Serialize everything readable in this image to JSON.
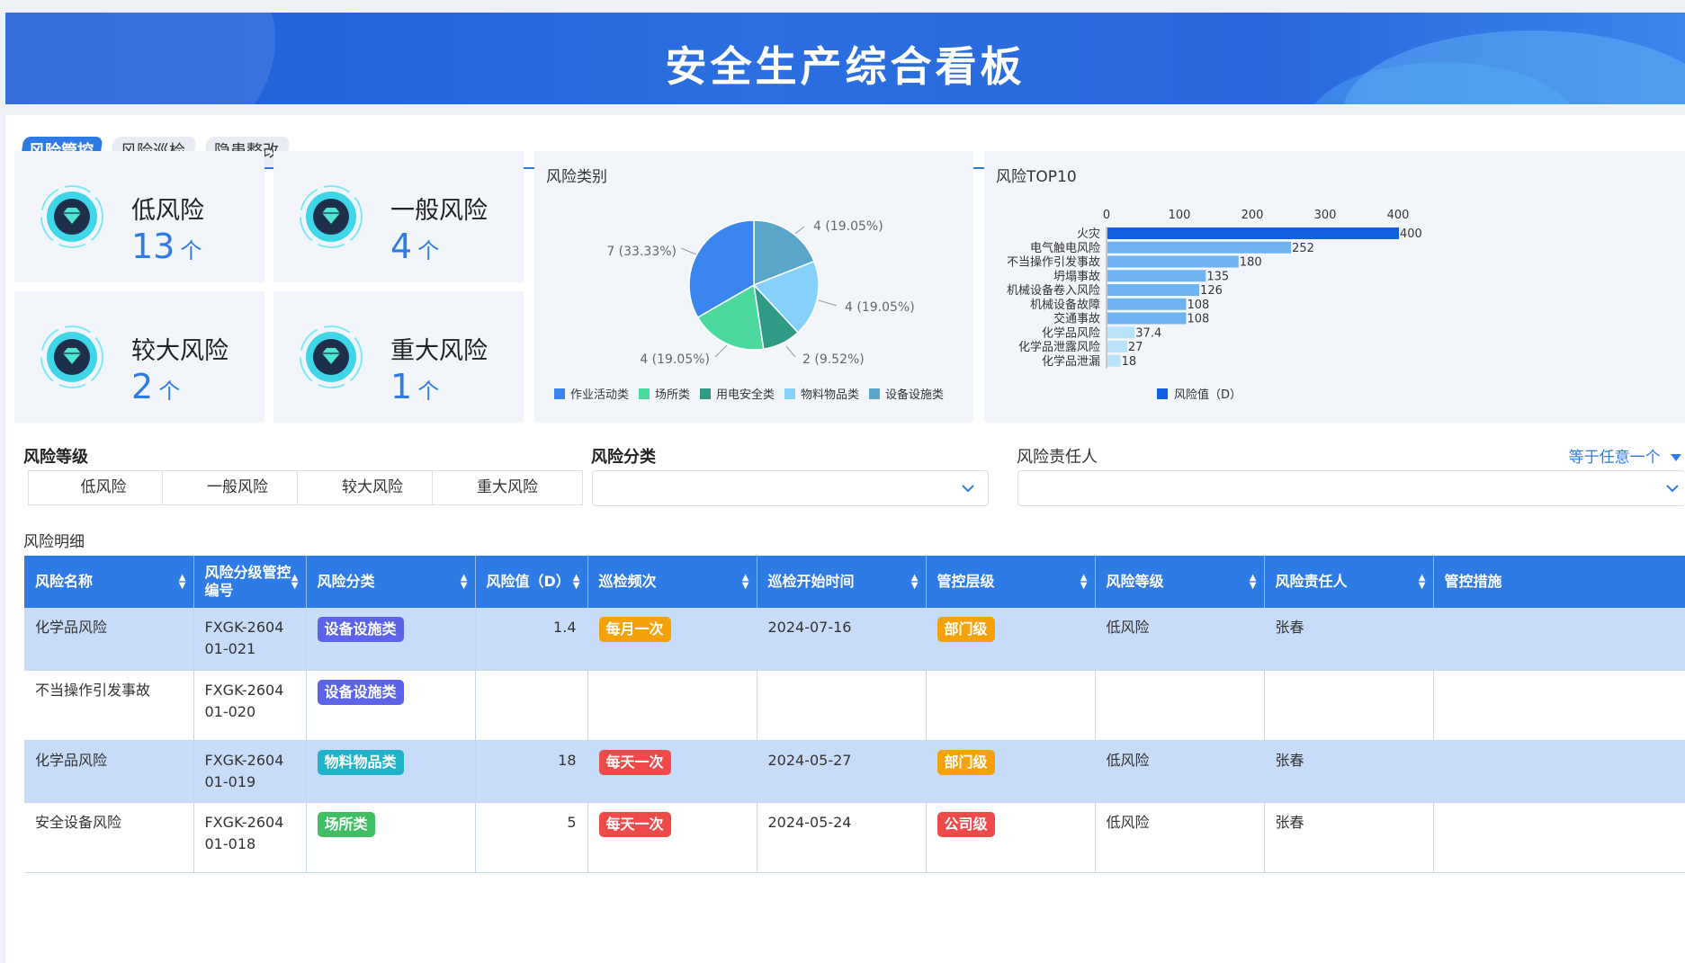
{
  "header": {
    "title": "安全生产综合看板"
  },
  "tabs": [
    {
      "label": "风险管控",
      "active": true
    },
    {
      "label": "风险巡检",
      "active": false
    },
    {
      "label": "隐患整改",
      "active": false
    }
  ],
  "kpis": [
    {
      "title": "低风险",
      "value": "13",
      "unit": "个"
    },
    {
      "title": "一般风险",
      "value": "4",
      "unit": "个"
    },
    {
      "title": "较大风险",
      "value": "2",
      "unit": "个"
    },
    {
      "title": "重大风险",
      "value": "1",
      "unit": "个"
    }
  ],
  "colors": {
    "primary": "#2f7be6",
    "banner": "#2968dc"
  },
  "chart_data": [
    {
      "type": "pie",
      "title": "风险类别",
      "labels": [
        "作业活动类",
        "场所类",
        "用电安全类",
        "物料物品类",
        "设备设施类"
      ],
      "values": [
        7,
        4,
        2,
        4,
        4
      ],
      "percent_labels": [
        "7 (33.33%)",
        "4 (19.05%)",
        "2 (9.52%)",
        "4 (19.05%)",
        "4 (19.05%)"
      ],
      "colors": [
        "#3b86ee",
        "#4cd99e",
        "#2f9a85",
        "#85d1fb",
        "#5aa6c9"
      ],
      "legend": "bottom"
    },
    {
      "type": "bar",
      "orientation": "horizontal",
      "title": "风险TOP10",
      "categories": [
        "火灾",
        "电气触电风险",
        "不当操作引发事故",
        "坍塌事故",
        "机械设备卷入风险",
        "机械设备故障",
        "交通事故",
        "化学品风险",
        "化学品泄露风险",
        "化学品泄漏"
      ],
      "series": [
        {
          "name": "风险值（D）",
          "values": [
            400,
            252,
            180,
            135,
            126,
            108,
            108,
            37.4,
            27,
            18
          ]
        }
      ],
      "value_labels": [
        "400",
        "252",
        "180",
        "135",
        "126",
        "108",
        "108",
        "37.4",
        "27",
        "18"
      ],
      "xticks": [
        "0",
        "100",
        "200",
        "300",
        "400"
      ],
      "xlim": [
        0,
        400
      ],
      "legend": "bottom"
    }
  ],
  "filters": {
    "level_label": "风险等级",
    "level_options": [
      "低风险",
      "一般风险",
      "较大风险",
      "重大风险"
    ],
    "category_label": "风险分类",
    "category_value": "",
    "owner_label": "风险责任人",
    "owner_mode": "等于任意一个",
    "owner_value": ""
  },
  "detail": {
    "title": "风险明细",
    "columns": [
      "风险名称",
      "风险分级管控编号",
      "风险分类",
      "风险值（D）",
      "巡检频次",
      "巡检开始时间",
      "管控层级",
      "风险等级",
      "风险责任人",
      "管控措施"
    ],
    "rows": [
      {
        "name": "化学品风险",
        "code": "FXGK-260401-021",
        "category": "设备设施类",
        "category_color": "#5b63e8",
        "value": "1.4",
        "freq": "每月一次",
        "freq_color": "#f5a10a",
        "start": "2024-07-16",
        "layer": "部门级",
        "layer_color": "#f5a10a",
        "level": "低风险",
        "owner": "张春",
        "measure": "",
        "hl": true
      },
      {
        "name": "不当操作引发事故",
        "code": "FXGK-260401-020",
        "category": "设备设施类",
        "category_color": "#5b63e8",
        "value": "",
        "freq": "",
        "freq_color": "",
        "start": "",
        "layer": "",
        "layer_color": "",
        "level": "",
        "owner": "",
        "measure": "",
        "hl": false
      },
      {
        "name": "化学品风险",
        "code": "FXGK-260401-019",
        "category": "物料物品类",
        "category_color": "#1fb3c9",
        "value": "18",
        "freq": "每天一次",
        "freq_color": "#ee4a4a",
        "start": "2024-05-27",
        "layer": "部门级",
        "layer_color": "#f5a10a",
        "level": "低风险",
        "owner": "张春",
        "measure": "",
        "hl": true
      },
      {
        "name": "安全设备风险",
        "code": "FXGK-260401-018",
        "category": "场所类",
        "category_color": "#3fbf62",
        "value": "5",
        "freq": "每天一次",
        "freq_color": "#ee4a4a",
        "start": "2024-05-24",
        "layer": "公司级",
        "layer_color": "#ee4a4a",
        "level": "低风险",
        "owner": "张春",
        "measure": "",
        "hl": false
      }
    ]
  }
}
